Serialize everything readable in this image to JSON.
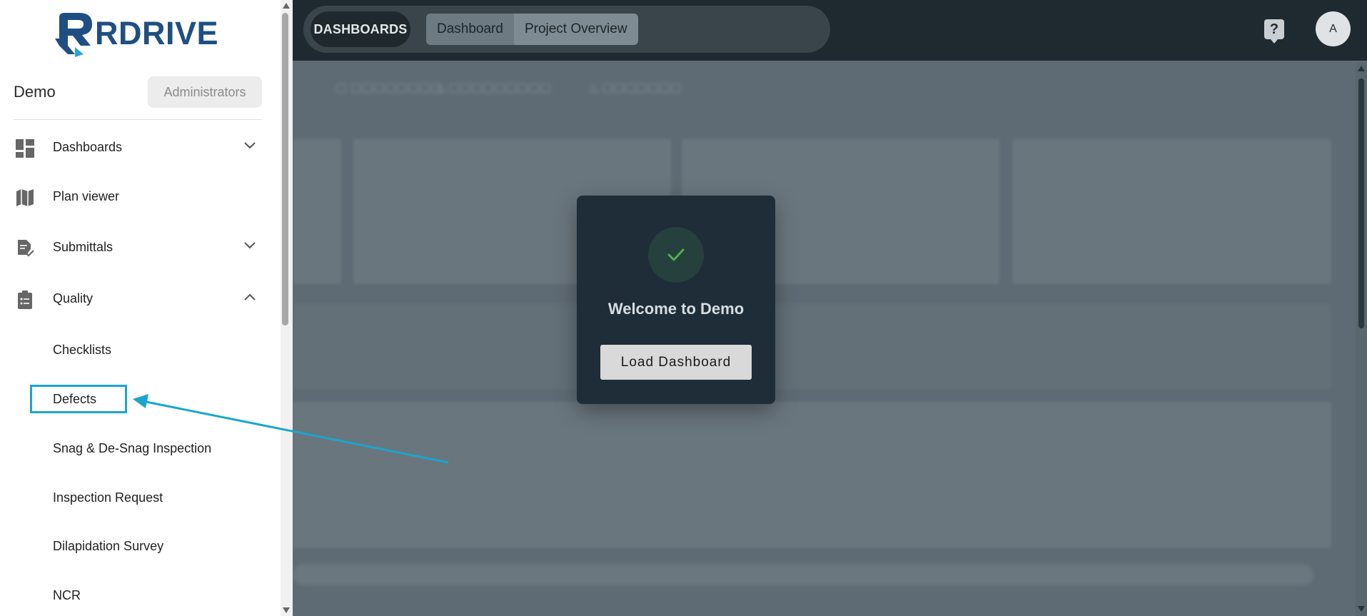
{
  "topbar": {
    "module_label": "DASHBOARDS",
    "tabs": [
      {
        "label": "Dashboard"
      },
      {
        "label": "Project Overview"
      }
    ],
    "help_glyph": "?",
    "avatar_initial": "A"
  },
  "sidebar": {
    "logo_text": "RDRIVE",
    "org_name": "Demo",
    "role_label": "Administrators",
    "nav": [
      {
        "label": "Dashboards",
        "icon": "dashboard-icon",
        "expandable": true,
        "expanded": false
      },
      {
        "label": "Plan viewer",
        "icon": "map-icon",
        "expandable": false
      },
      {
        "label": "Submittals",
        "icon": "document-check-icon",
        "expandable": true,
        "expanded": false
      },
      {
        "label": "Quality",
        "icon": "clipboard-list-icon",
        "expandable": true,
        "expanded": true
      }
    ],
    "quality_items": [
      {
        "label": "Checklists"
      },
      {
        "label": "Defects"
      },
      {
        "label": "Snag & De-Snag Inspection"
      },
      {
        "label": "Inspection Request"
      },
      {
        "label": "Dilapidation Survey"
      },
      {
        "label": "NCR"
      }
    ]
  },
  "modal": {
    "title": "Welcome to Demo",
    "button_label": "Load Dashboard"
  },
  "colors": {
    "accent_highlight": "#1aa6cc",
    "topbar_bg": "#1f2a30",
    "modal_bg": "#1e2d38",
    "brand_blue": "#1f4f82",
    "success_green": "#4caf50"
  }
}
